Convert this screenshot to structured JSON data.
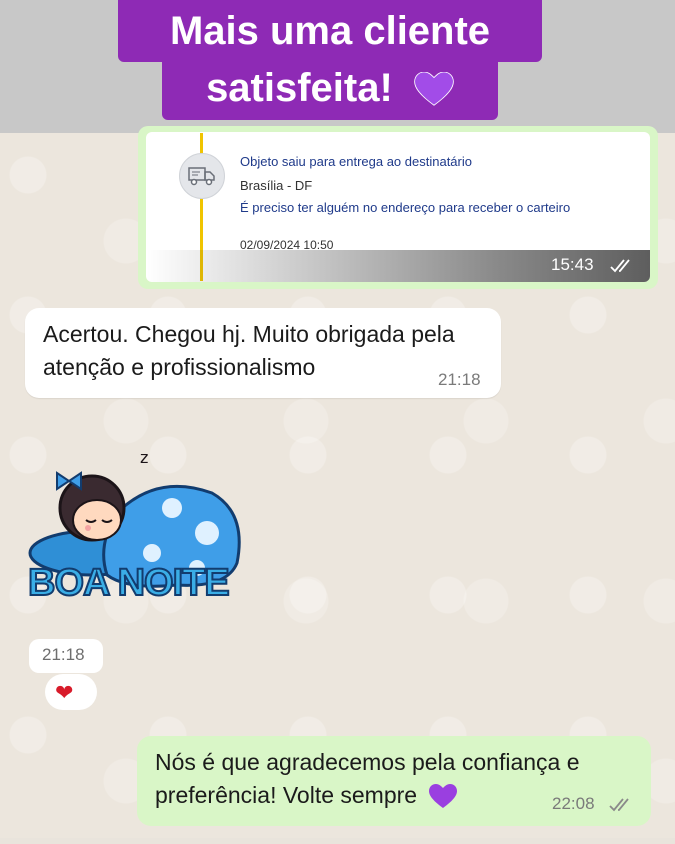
{
  "banner": {
    "line1": "Mais uma cliente",
    "line2": "satisfeita!",
    "emoji": "purple-heart"
  },
  "tracking_card": {
    "title": "Objeto saiu para entrega ao destinatário",
    "city": "Brasília - DF",
    "note": "É preciso ter alguém no endereço para receber o carteiro",
    "date": "02/09/2024 10:50",
    "time": "15:43",
    "status_icon": "double-check-icon",
    "icon": "truck-icon"
  },
  "incoming_message": {
    "text": "Acertou. Chegou hj. Muito obrigada pela atenção e profissionalismo",
    "time": "21:18"
  },
  "sticker": {
    "caption": "BOA NOITE",
    "image": "sleeping-girl-sticker"
  },
  "sticker_time": "21:18",
  "reaction": {
    "emoji": "❤"
  },
  "outgoing_message": {
    "text": "Nós é que agradecemos pela confiança e preferência! Volte sempre",
    "emoji": "purple-heart",
    "time": "22:08",
    "status_icon": "double-check-icon"
  },
  "colors": {
    "banner_bg": "#8e2ab5",
    "outgoing_bubble": "#d9f6c7",
    "incoming_bubble": "#ffffff",
    "chat_bg": "#ece6dd",
    "track_line": "#f0c400"
  }
}
